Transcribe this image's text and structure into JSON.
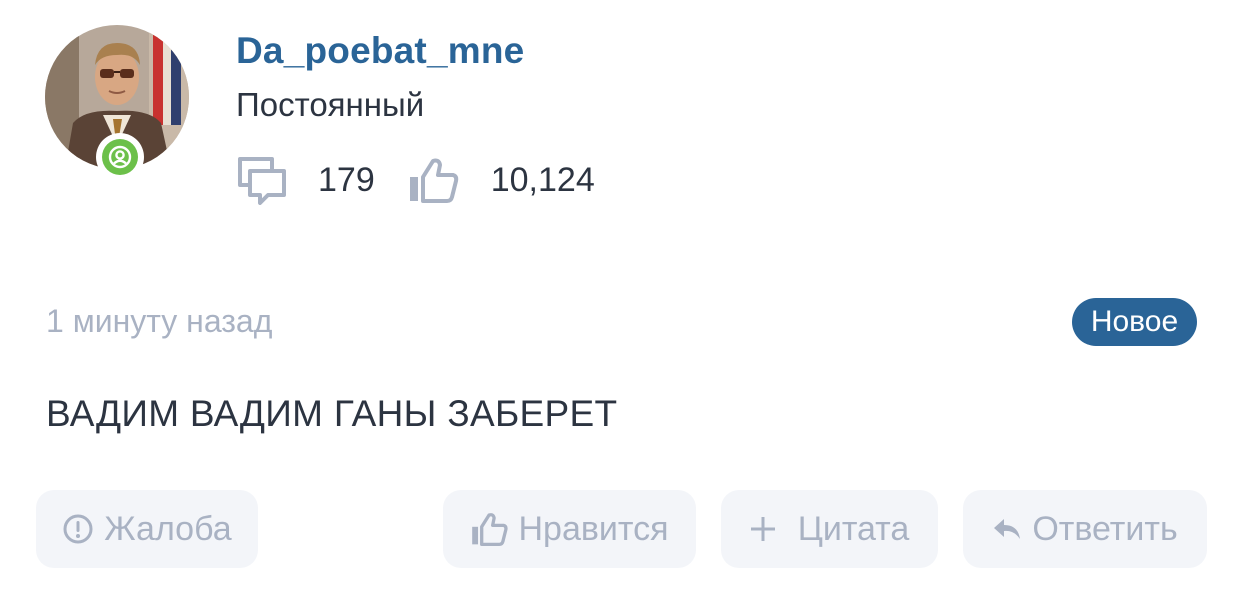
{
  "user": {
    "username": "Da_poebat_mne",
    "rank": "Постоянный",
    "online_status": "online"
  },
  "stats": {
    "comments_icon": "comments-icon",
    "comments_count": "179",
    "likes_icon": "thumbs-up-icon",
    "likes_count": "10,124"
  },
  "post": {
    "timestamp": "1 минуту назад",
    "badge": "Новое",
    "message": "ВАДИМ ВАДИМ ГАНЫ ЗАБЕРЕТ"
  },
  "actions": {
    "report_label": "Жалоба",
    "like_label": "Нравится",
    "quote_label": "Цитата",
    "reply_label": "Ответить"
  },
  "colors": {
    "accent": "#2a6497",
    "text": "#2c3441",
    "muted": "#a9b2c3",
    "button_bg": "#f3f5f9",
    "online": "#6cc04a"
  }
}
